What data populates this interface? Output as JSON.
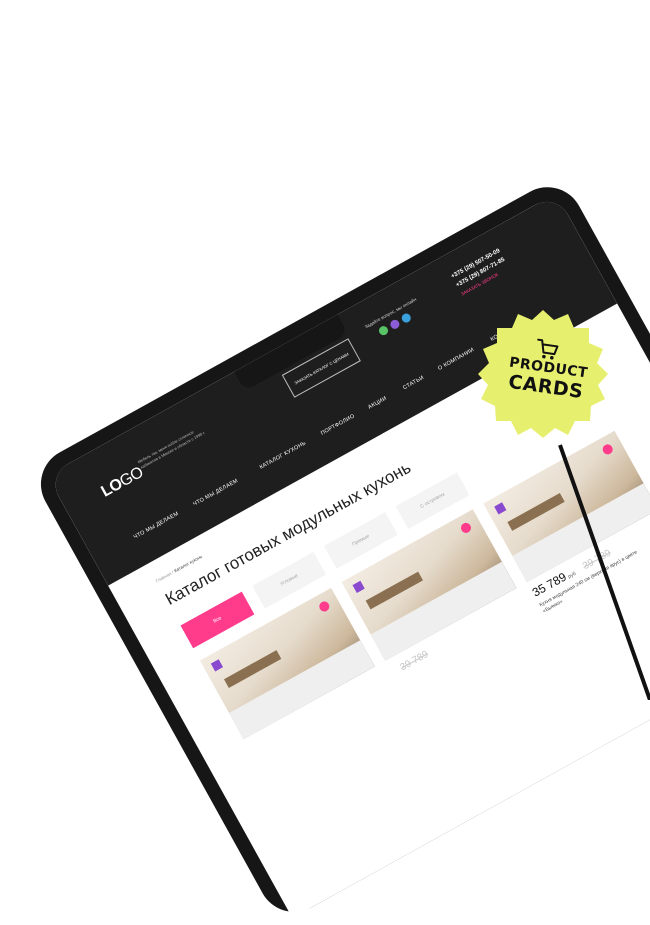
{
  "sticker": {
    "line1": "PRODUCT",
    "line2": "CARDS",
    "icon": "cart-icon",
    "color": "#e7ef6e"
  },
  "colors": {
    "accent": "#ff3b8c",
    "header": "#1e1e1e",
    "squiggle": "#e2348c"
  },
  "header": {
    "logo_bold": "LO",
    "logo_light": "GO",
    "tagline": "Мебель так, меня нобле отличное кабинетов в Минске и области с 1990 г.",
    "call_button": "ЗАКАЗАТЬ КАТАЛОГ С ЦЕНАМИ",
    "question": "Задайте вопрос, мы онлайн",
    "messengers": [
      "viber-icon",
      "telegram-icon",
      "whatsapp-icon"
    ],
    "phone1": "+375 (29) 507-50-09",
    "phone2": "+375 (29) 807-71-85",
    "order_call": "ЗАКАЗАТЬ ЗВОНОК"
  },
  "nav": [
    "ЧТО МЫ ДЕЛАЕМ",
    "ЧТО МЫ ДЕЛАЕМ",
    "КАТАЛОГ КУХОНЬ",
    "ПОРТФОЛИО",
    "АКЦИИ",
    "СТАТЬИ",
    "О КОМПАНИИ",
    "КОНТ"
  ],
  "breadcrumb": {
    "home": "Главная",
    "current": "Каталог кухонь"
  },
  "title": "Каталог готовых модульных кухонь",
  "filters": [
    "Все",
    "Угловые",
    "Прямые",
    "С островом"
  ],
  "cards": [
    {
      "price": "",
      "old_price": "",
      "desc": ""
    },
    {
      "price": "",
      "old_price": "39 789",
      "desc": ""
    },
    {
      "price": "35 789",
      "old_price": "39 789",
      "currency": "руб",
      "desc": "Кухня модульная 240 см (верхняя ярус) в цвете «Бьянко»"
    }
  ]
}
